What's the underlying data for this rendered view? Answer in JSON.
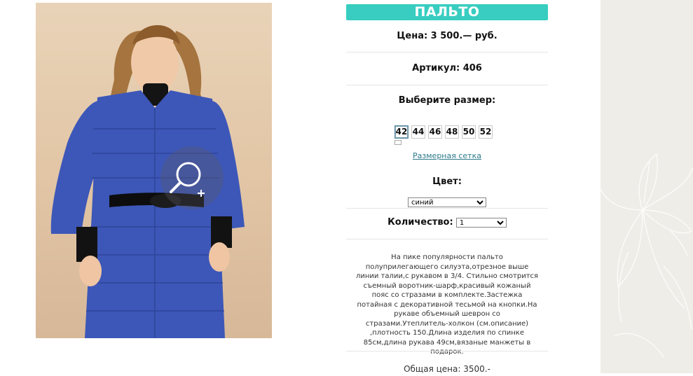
{
  "product": {
    "title": "ПАЛЬТО",
    "price": "Цена: 3 500.— руб.",
    "article": "Артикул: 406",
    "size_heading": "Выберите размер:",
    "sizes": [
      "42",
      "44",
      "46",
      "48",
      "50",
      "52"
    ],
    "selected_size": "42",
    "size_chart_link": "Размерная сетка",
    "color_heading": "Цвет:",
    "color_value": "синий",
    "quantity_label": "Количество:",
    "quantity_value": "1",
    "description": "На пике популярности пальто полуприлегающего силуэта,отрезное выше линии талии,с рукавом в 3/4. Стильно смотрится съемный воротник-шарф,красивый кожаный пояс со стразами в комплекте.Застежка потайная с декоративной тесьмой на кнопки.На рукаве объемный шеврон со стразами.Утеплитель-холкон (см.описание) ,плотность 150.Длина изделия по спинке 85см,длина рукава 49см,вязаные манжеты в подарок.",
    "total": "Общая цена: 3500.-"
  },
  "colors": {
    "accent": "#38cdc0",
    "coat": "#3d57b8",
    "side_panel": "#efede7"
  },
  "icons": {
    "zoom": "zoom-in-icon"
  }
}
